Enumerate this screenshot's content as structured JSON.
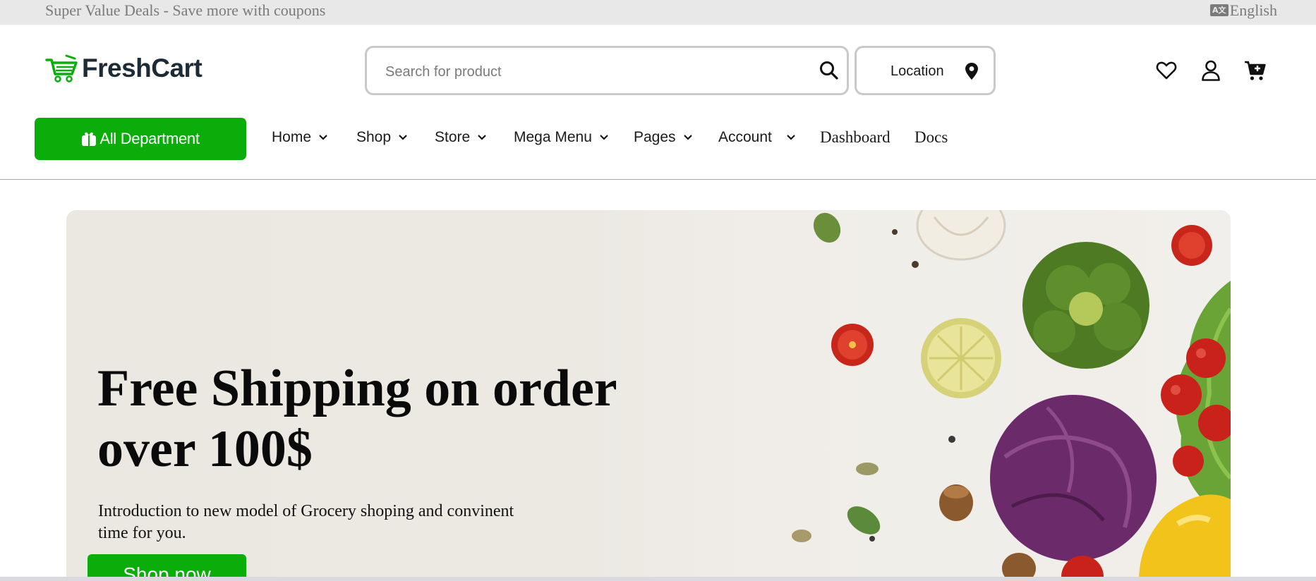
{
  "topbar": {
    "promo": "Super Value Deals - Save more with coupons",
    "language": "English"
  },
  "brand": {
    "name": "FreshCart",
    "color": "#0aad0a"
  },
  "search": {
    "placeholder": "Search for product",
    "value": ""
  },
  "location": {
    "label": "Location"
  },
  "header_icons": [
    "heart-icon",
    "user-icon",
    "cart-icon"
  ],
  "nav": {
    "department_label": "All Department",
    "items": [
      {
        "label": "Home"
      },
      {
        "label": "Shop"
      },
      {
        "label": "Store"
      },
      {
        "label": "Mega Menu"
      },
      {
        "label": "Pages"
      },
      {
        "label": "Account"
      },
      {
        "label": "Dashboard"
      },
      {
        "label": "Docs"
      }
    ]
  },
  "hero": {
    "title": "Free Shipping on order over 100$",
    "subtitle": "Introduction to new model of Grocery shoping and convinent time for you.",
    "cta": "Shop now"
  },
  "colors": {
    "accent": "#0aad0a",
    "heading": "#1d2b36"
  }
}
